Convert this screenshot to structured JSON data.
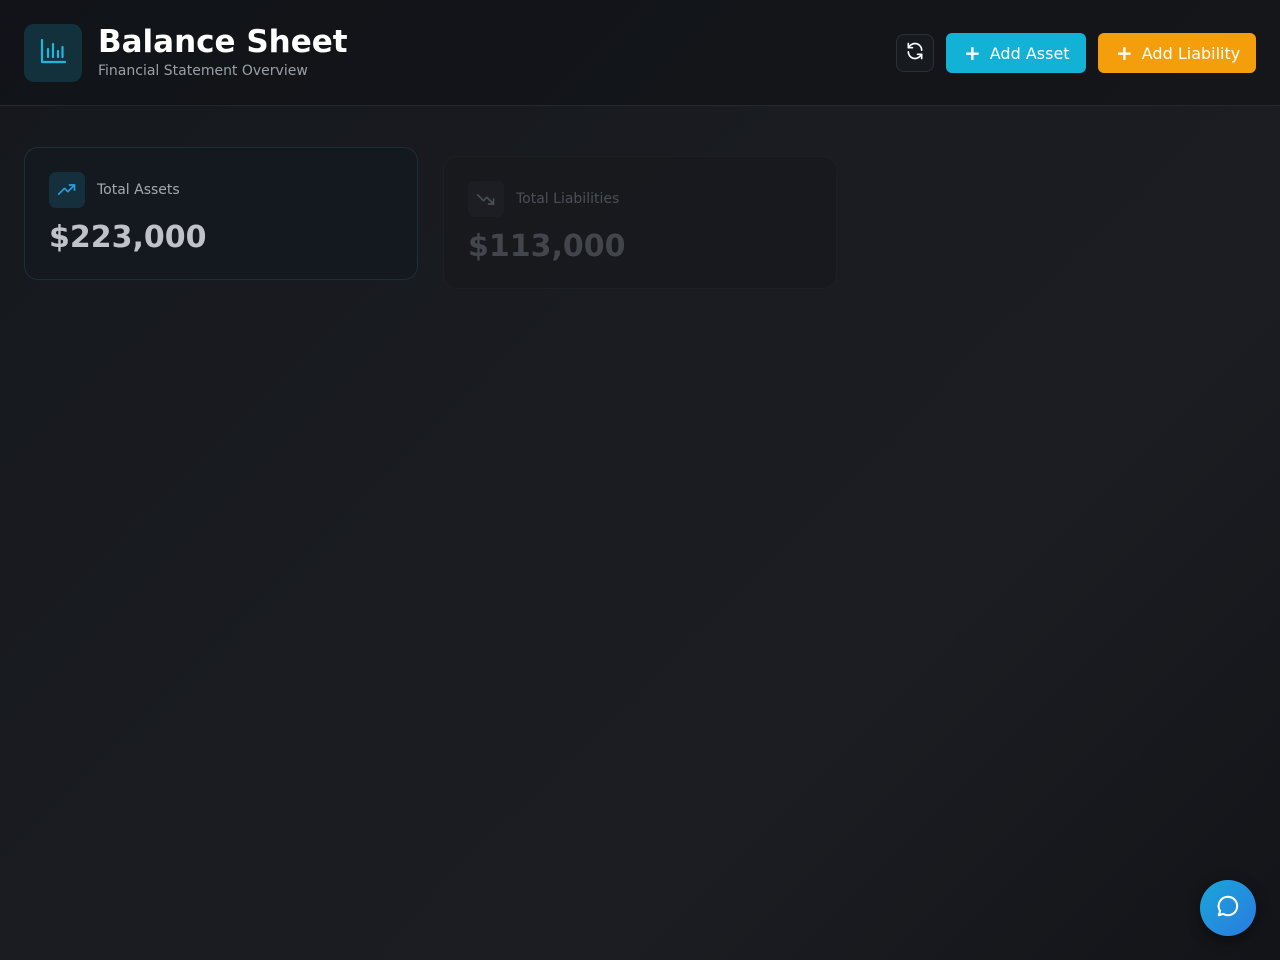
{
  "header": {
    "title": "Balance Sheet",
    "subtitle": "Financial Statement Overview",
    "logo_icon": "bar-chart-icon",
    "refresh_icon": "refresh-icon",
    "add_asset_label": "Add Asset",
    "add_liability_label": "Add Liability",
    "add_icon": "plus-icon"
  },
  "summary_cards": {
    "assets": {
      "label": "Total Assets",
      "value": "$223,000",
      "icon": "trending-up-icon"
    },
    "liabilities": {
      "label": "Total Liabilities",
      "value": "$113,000",
      "icon": "trending-down-icon"
    }
  },
  "chat": {
    "icon": "chat-bubble-icon"
  },
  "colors": {
    "accent_cyan": "#11b2d6",
    "accent_orange": "#f59e0b",
    "chat_gradient_start": "#19a6d8",
    "chat_gradient_end": "#2a7be0",
    "background": "#1a1c21"
  }
}
